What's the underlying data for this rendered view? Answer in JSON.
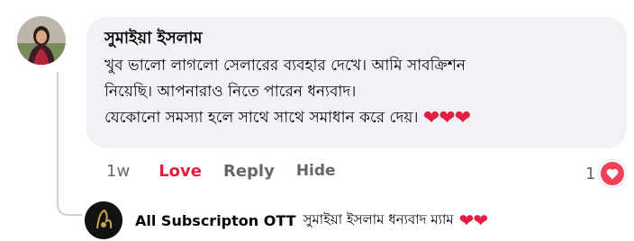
{
  "comment": {
    "author": "সুমাইয়া ইসলাম",
    "text_lines": [
      "খুব ভালো লাগলো সেলারের ব্যবহার দেখে। আমি সাবক্রিশন",
      "নিয়েছি। আপনারাও নিতে পারেন ধন্যবাদ।",
      "যেকোনো সমস্যা হলে সাথে সাথে সমাধান করে দেয়।"
    ],
    "hearts": "❤❤❤",
    "actions": {
      "time": "1w",
      "love": "Love",
      "reply": "Reply",
      "hide": "Hide"
    },
    "reaction_count": "1",
    "reaction_icon": "heart-icon"
  },
  "reply": {
    "author": "All Subscripton OTT",
    "text": "সুমাইয়া ইসলাম ধন্যবাদ ম্যাম",
    "hearts": "❤❤"
  },
  "colors": {
    "love": "#e41e3f",
    "bubble": "#f0f2f5",
    "muted": "#65676b"
  }
}
